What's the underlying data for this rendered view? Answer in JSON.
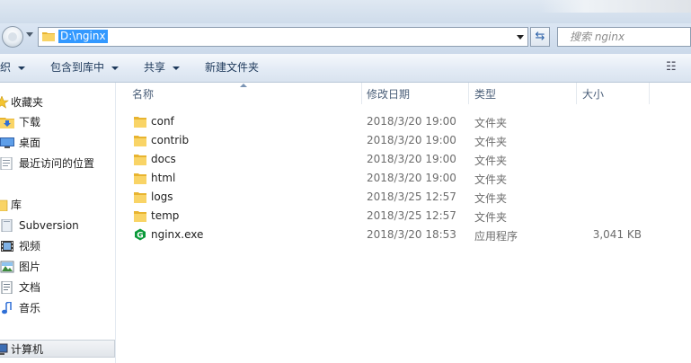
{
  "address": {
    "path": "D:\\nginx",
    "search_placeholder": "搜索 nginx"
  },
  "toolbar": {
    "organize_label": "织",
    "include_library_label": "包含到库中",
    "share_label": "共享",
    "new_folder_label": "新建文件夹"
  },
  "nav": {
    "items": [
      {
        "label": "收藏夹",
        "icon": "star-icon"
      },
      {
        "label": "下载",
        "icon": "download-folder-icon"
      },
      {
        "label": "桌面",
        "icon": "desktop-icon"
      },
      {
        "label": "最近访问的位置",
        "icon": "recent-places-icon"
      },
      {
        "label": "库",
        "icon": "library-icon"
      },
      {
        "label": "Subversion",
        "icon": "library-folder-icon"
      },
      {
        "label": "视频",
        "icon": "video-icon"
      },
      {
        "label": "图片",
        "icon": "picture-icon"
      },
      {
        "label": "文档",
        "icon": "document-icon"
      },
      {
        "label": "音乐",
        "icon": "music-icon"
      },
      {
        "label": "计算机",
        "icon": "computer-icon"
      }
    ]
  },
  "columns": {
    "name": "名称",
    "modified": "修改日期",
    "type": "类型",
    "size": "大小"
  },
  "files": [
    {
      "name": "conf",
      "modified": "2018/3/20 19:00",
      "type": "文件夹",
      "size": "",
      "icon": "folder-icon"
    },
    {
      "name": "contrib",
      "modified": "2018/3/20 19:00",
      "type": "文件夹",
      "size": "",
      "icon": "folder-icon"
    },
    {
      "name": "docs",
      "modified": "2018/3/20 19:00",
      "type": "文件夹",
      "size": "",
      "icon": "folder-icon"
    },
    {
      "name": "html",
      "modified": "2018/3/20 19:00",
      "type": "文件夹",
      "size": "",
      "icon": "folder-icon"
    },
    {
      "name": "logs",
      "modified": "2018/3/25 12:57",
      "type": "文件夹",
      "size": "",
      "icon": "folder-icon"
    },
    {
      "name": "temp",
      "modified": "2018/3/25 12:57",
      "type": "文件夹",
      "size": "",
      "icon": "folder-icon"
    },
    {
      "name": "nginx.exe",
      "modified": "2018/3/20 18:53",
      "type": "应用程序",
      "size": "3,041 KB",
      "icon": "nginx-exe-icon"
    }
  ],
  "colors": {
    "selection": "#3399ff",
    "folder": "#f9d466",
    "nginx_green": "#0b9a3a"
  }
}
